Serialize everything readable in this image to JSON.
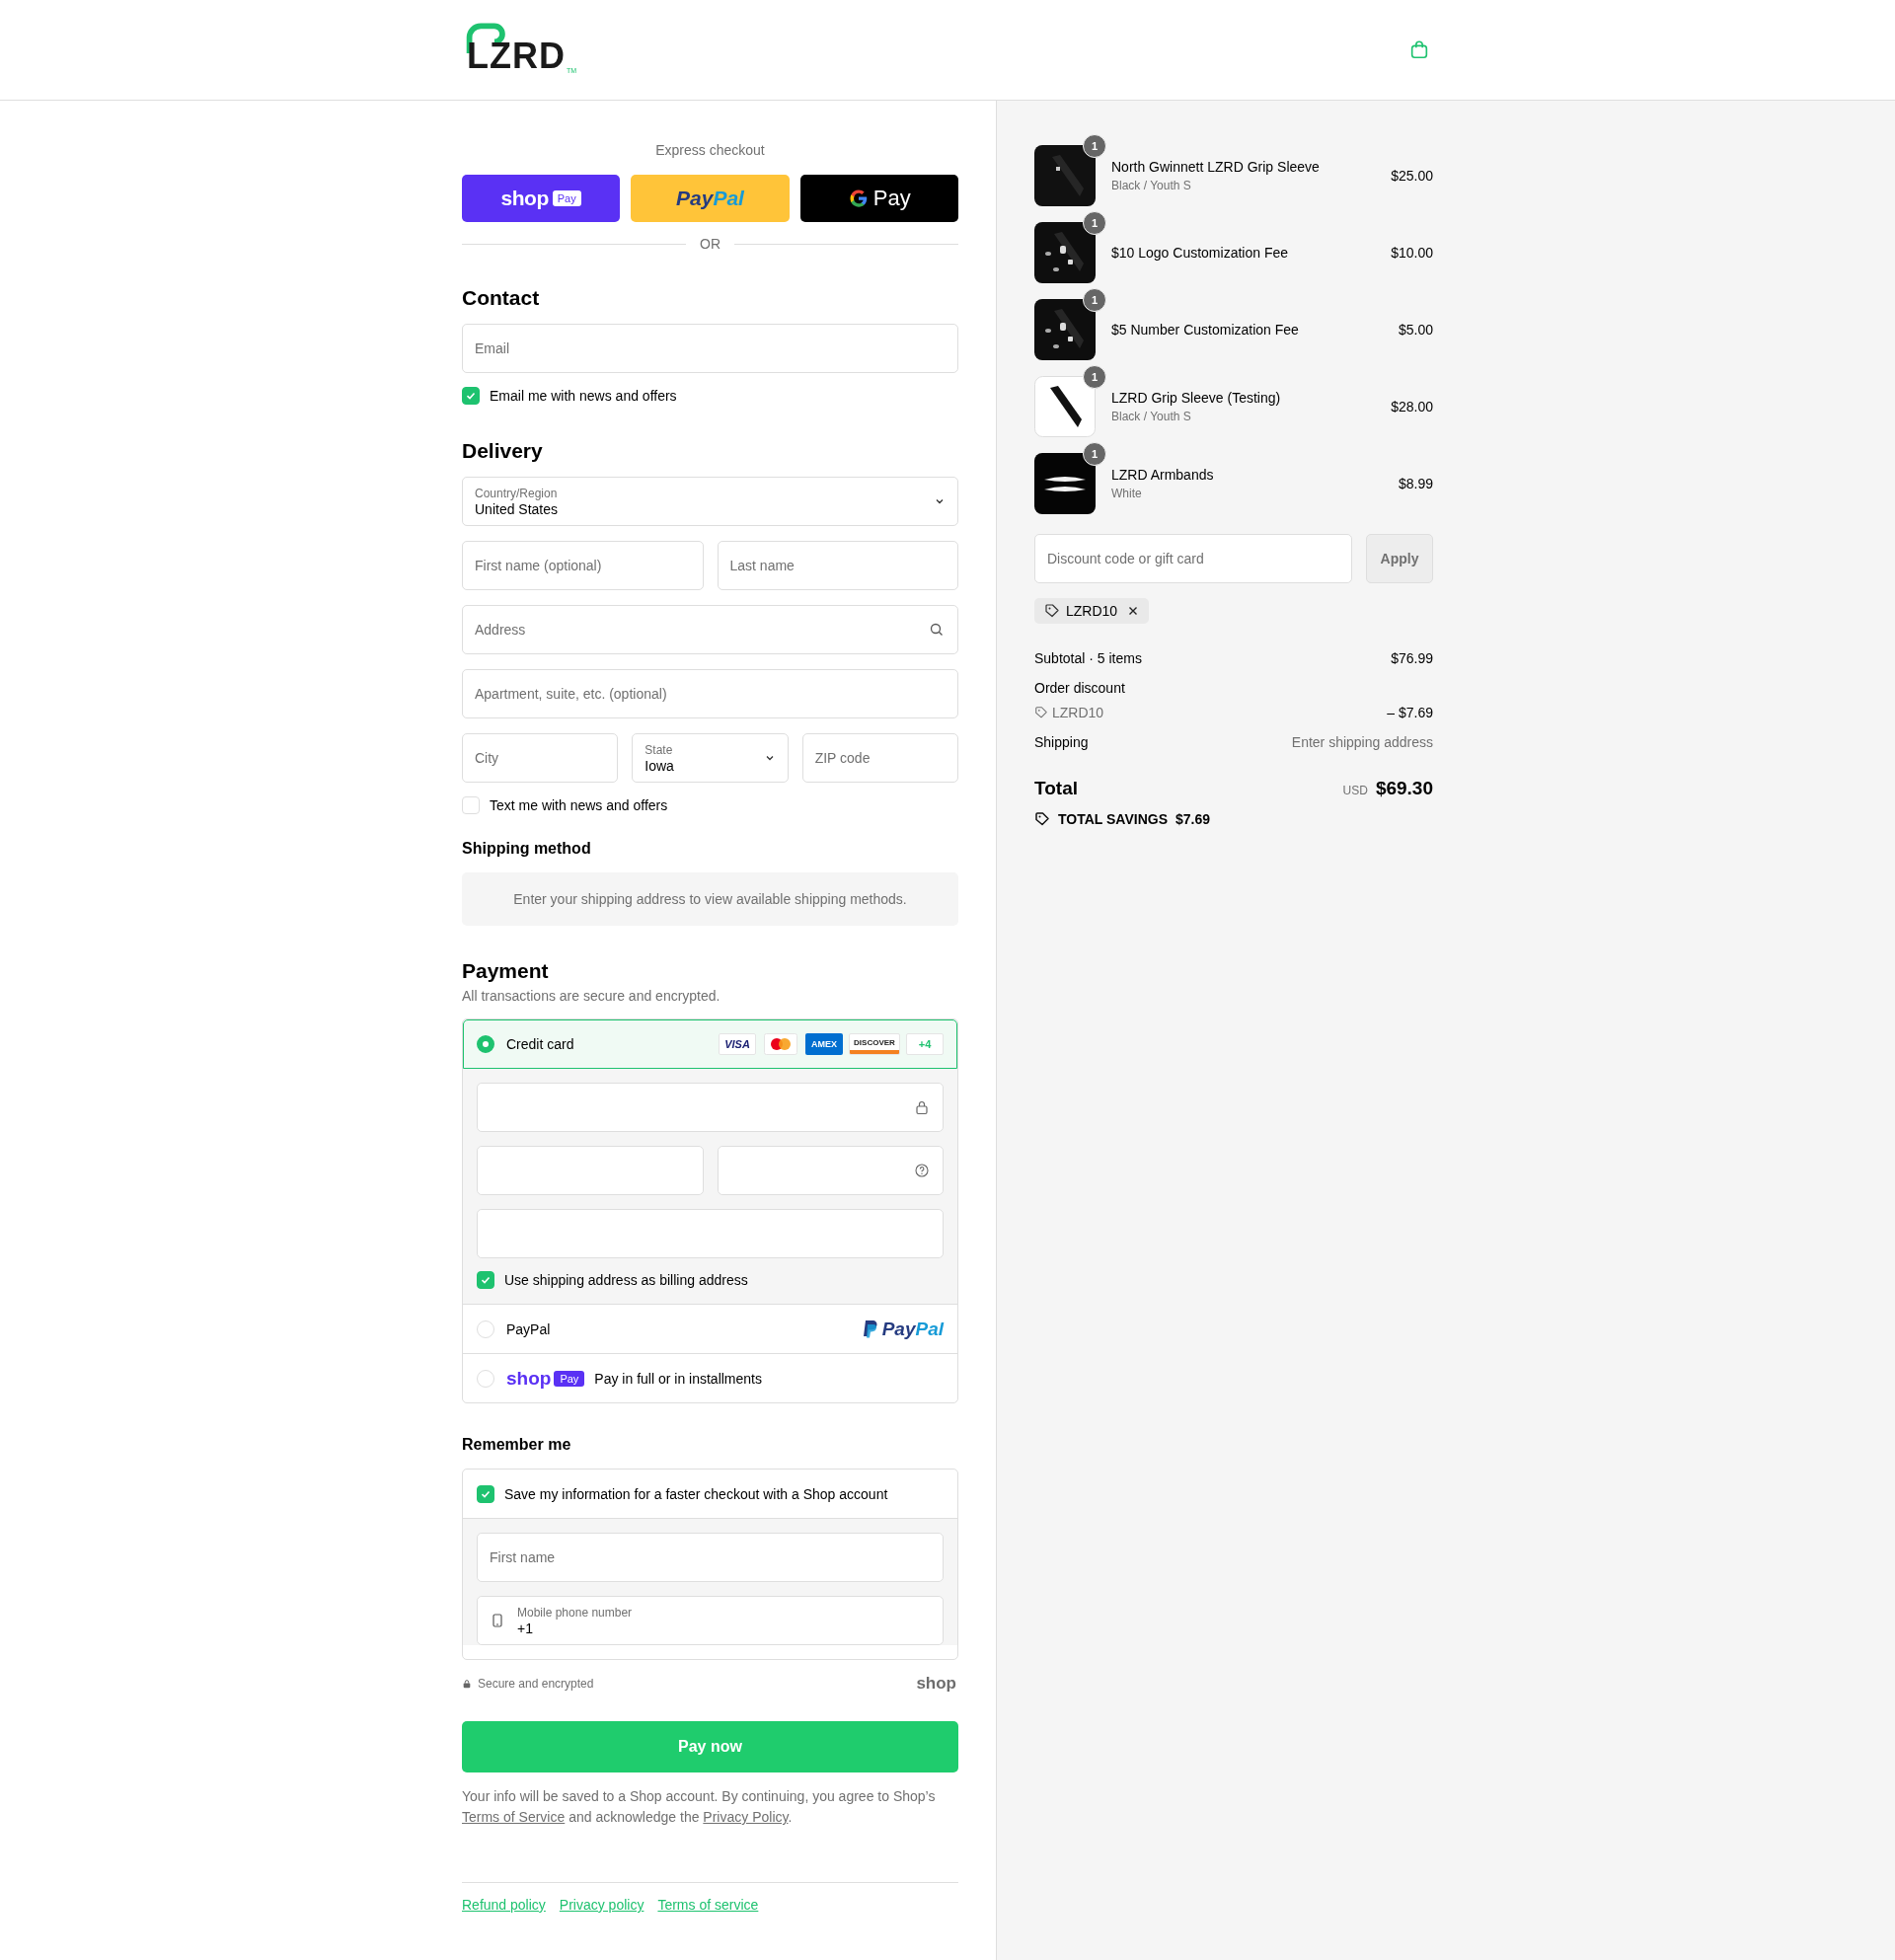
{
  "header": {
    "logo": {
      "text": "LZRD",
      "mark": "TM"
    }
  },
  "express_checkout": {
    "title": "Express checkout",
    "buttons": [
      {
        "kind": "shop_pay",
        "label": "shop",
        "badge": "Pay"
      },
      {
        "kind": "paypal",
        "label": "Pay",
        "label_2": "Pal"
      },
      {
        "kind": "google_pay",
        "label": "Pay"
      }
    ],
    "divider": "OR"
  },
  "contact": {
    "heading": "Contact",
    "email": {
      "placeholder": "Email"
    },
    "newsletter": {
      "label": "Email me with news and offers",
      "checked": true
    }
  },
  "delivery": {
    "heading": "Delivery",
    "country": {
      "label": "Country/Region",
      "value": "United States"
    },
    "first_name": {
      "placeholder": "First name (optional)"
    },
    "last_name": {
      "placeholder": "Last name"
    },
    "address": {
      "placeholder": "Address"
    },
    "apartment": {
      "placeholder": "Apartment, suite, etc. (optional)"
    },
    "city": {
      "placeholder": "City"
    },
    "state": {
      "label": "State",
      "value": "Iowa"
    },
    "zip": {
      "placeholder": "ZIP code"
    },
    "sms": {
      "label": "Text me with news and offers",
      "checked": false
    }
  },
  "shipping_method": {
    "heading": "Shipping method",
    "message": "Enter your shipping address to view available shipping methods."
  },
  "payment": {
    "heading": "Payment",
    "subtitle": "All transactions are secure and encrypted.",
    "methods": [
      {
        "kind": "credit_card",
        "label": "Credit card",
        "selected": true,
        "brands": [
          {
            "kind": "visa",
            "text": "VISA"
          },
          {
            "kind": "mastercard"
          },
          {
            "kind": "amex",
            "text": "AMEX"
          },
          {
            "kind": "discover",
            "text": "DISCOVER"
          }
        ],
        "more": "+4",
        "billing": {
          "label": "Use shipping address as billing address",
          "checked": true
        }
      },
      {
        "kind": "paypal",
        "label": "PayPal",
        "selected": false,
        "logo": "Pay",
        "logo_2": "Pal"
      },
      {
        "kind": "shop_pay",
        "label": "Pay in full or in installments",
        "selected": false,
        "logo": "shop",
        "badge": "Pay"
      }
    ]
  },
  "remember_me": {
    "heading": "Remember me",
    "save": {
      "label": "Save my information for a faster checkout with a Shop account",
      "checked": true
    },
    "first_name": {
      "placeholder": "First name"
    },
    "phone": {
      "label": "Mobile phone number",
      "value": "+1"
    }
  },
  "secure": {
    "text": "Secure and encrypted",
    "logo": "shop"
  },
  "pay_button": "Pay now",
  "legal": [
    {
      "kind": "text",
      "text": "Your info will be saved to a Shop account. By continuing, you agree to Shop’s "
    },
    {
      "kind": "link",
      "text": "Terms of Service"
    },
    {
      "kind": "text",
      "text": " and acknowledge the "
    },
    {
      "kind": "link",
      "text": "Privacy Policy"
    },
    {
      "kind": "text",
      "text": "."
    }
  ],
  "footer_links": [
    "Refund policy",
    "Privacy policy",
    "Terms of service"
  ],
  "summary": {
    "items": [
      {
        "name": "North Gwinnett LZRD Grip Sleeve",
        "variant": "Black / Youth S",
        "price": "$25.00",
        "quantity": "1"
      },
      {
        "name": "$10 Logo Customization Fee",
        "price": "$10.00",
        "quantity": "1"
      },
      {
        "name": "$5 Number Customization Fee",
        "price": "$5.00",
        "quantity": "1"
      },
      {
        "name": "LZRD Grip Sleeve (Testing)",
        "variant": "Black / Youth S",
        "price": "$28.00",
        "quantity": "1"
      },
      {
        "name": "LZRD Armbands",
        "variant": "White",
        "price": "$8.99",
        "quantity": "1"
      }
    ],
    "discount": {
      "placeholder": "Discount code or gift card",
      "button": "Apply",
      "disabled": true,
      "applied_code": "LZRD10"
    },
    "subtotal": {
      "label": "Subtotal · 5 items",
      "value": "$76.99"
    },
    "order_discount": {
      "label": "Order discount",
      "code": "LZRD10",
      "value": "– $7.69"
    },
    "shipping": {
      "label": "Shipping",
      "value": "Enter shipping address"
    },
    "total": {
      "label": "Total",
      "currency": "USD",
      "value": "$69.30"
    },
    "savings": {
      "label": "TOTAL SAVINGS",
      "value": "$7.69"
    }
  }
}
